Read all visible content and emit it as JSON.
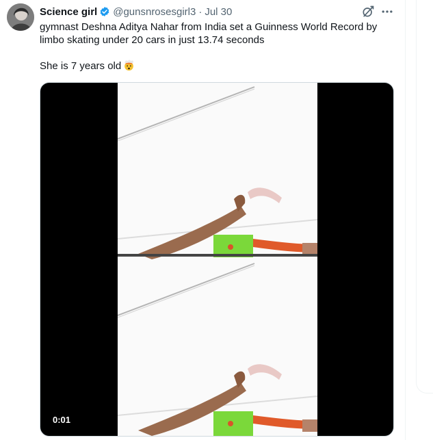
{
  "tweet": {
    "author": {
      "display_name": "Science girl",
      "handle": "@gunsnrosesgirl3",
      "verified": true
    },
    "separator": "·",
    "date": "Jul 30",
    "text_line1": "gymnast Deshna Aditya Nahar from India set a Guinness World Record by limbo skating under 20 cars in just 13.74 seconds",
    "text_line2": "She is 7 years old",
    "emoji": "exploding-head-emoji",
    "media": {
      "type": "video",
      "timestamp": "0:01"
    }
  },
  "icons": {
    "verified": "verified-badge-icon",
    "grok": "grok-icon",
    "more": "more-icon"
  },
  "colors": {
    "verified_blue": "#1d9bf0",
    "text_primary": "#0f1419",
    "text_secondary": "#536471",
    "border": "#cfd9de"
  }
}
